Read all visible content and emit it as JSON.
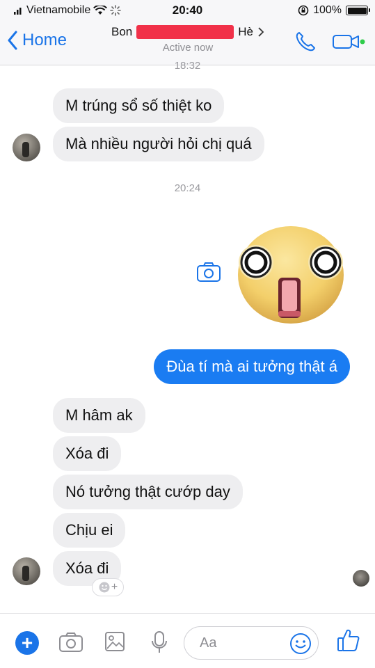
{
  "status_bar": {
    "carrier": "Vietnamobile",
    "time": "20:40",
    "battery": "100%"
  },
  "nav": {
    "back_label": "Home",
    "contact_name_start": "Bon",
    "contact_name_end": "Hè",
    "status": "Active now"
  },
  "chat": {
    "timestamp_top": "18:32",
    "incoming_1": [
      "M trúng sổ số thiệt ko",
      "Mà nhiều người hỏi chị quá"
    ],
    "timestamp_mid": "20:24",
    "outgoing": "Đùa tí mà ai tưởng thật á",
    "incoming_2": [
      "M hâm ak",
      "Xóa đi",
      "Nó tưởng thật cướp day",
      "Chịu ei",
      "Xóa đi"
    ],
    "sticker": "shocked-face-sticker"
  },
  "composer": {
    "placeholder": "Aa"
  },
  "colors": {
    "accent": "#1a74e8",
    "outgoing_bubble": "#1a7cf2",
    "incoming_bubble": "#eeeef0",
    "redaction": "#f0203a"
  }
}
